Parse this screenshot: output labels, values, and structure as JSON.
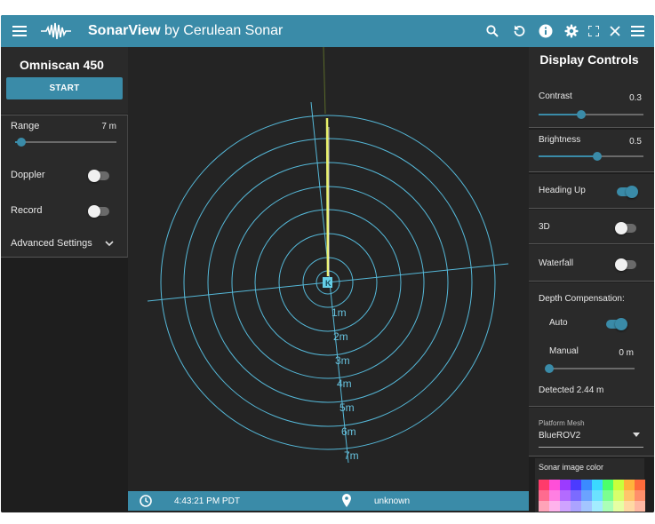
{
  "app": {
    "title_brand": "SonarView",
    "title_rest": " by Cerulean Sonar"
  },
  "topbar": {
    "icons": [
      "menu-icon",
      "sonar-logo-icon",
      "search-icon",
      "reset-icon",
      "info-icon",
      "gear-icon",
      "fullscreen-icon",
      "close-icon",
      "menu-icon"
    ]
  },
  "left": {
    "device_name": "Omniscan 450",
    "start_label": "START",
    "range_label": "Range",
    "range_value": "7 m",
    "range_fraction": 0.06,
    "doppler_label": "Doppler",
    "doppler_on": false,
    "record_label": "Record",
    "record_on": false,
    "advanced_label": "Advanced Settings"
  },
  "viewport": {
    "ring_labels": [
      "1m",
      "2m",
      "3m",
      "4m",
      "5m",
      "6m",
      "7m"
    ],
    "marker": "K"
  },
  "bottom": {
    "time": "4:43:21 PM PDT",
    "location": "unknown"
  },
  "right": {
    "title": "Display Controls",
    "contrast_label": "Contrast",
    "contrast_value": "0.3",
    "contrast_fraction": 0.41,
    "brightness_label": "Brightness",
    "brightness_value": "0.5",
    "brightness_fraction": 0.56,
    "heading_up_label": "Heading Up",
    "heading_up_on": true,
    "three_d_label": "3D",
    "three_d_on": false,
    "waterfall_label": "Waterfall",
    "waterfall_on": false,
    "depth_comp_label": "Depth Compensation:",
    "auto_label": "Auto",
    "auto_on": true,
    "manual_label": "Manual",
    "manual_value": "0 m",
    "manual_fraction": 0.0,
    "detected_label": "Detected 2.44 m",
    "platform_mesh_label": "Platform Mesh",
    "platform_mesh_value": "BlueROV2",
    "sonar_color_label": "Sonar image color",
    "palette": [
      "#ff3b6b",
      "#ff4fd8",
      "#9b3bff",
      "#4b3bff",
      "#3b8bff",
      "#3bd8ff",
      "#4bff6b",
      "#c8ff3b",
      "#ffb33b",
      "#ff6b3b",
      "#ff6b8f",
      "#ff7fe2",
      "#b36bff",
      "#7b6bff",
      "#6ba3ff",
      "#6be2ff",
      "#7bff8f",
      "#d8ff6b",
      "#ffc56b",
      "#ff8f6b",
      "#ffa3b8",
      "#ffb3ec",
      "#cfa3ff",
      "#aba3ff",
      "#a3c5ff",
      "#a3ecff",
      "#abffb8",
      "#e6ffa3",
      "#ffd9a3",
      "#ffb8a3"
    ]
  }
}
